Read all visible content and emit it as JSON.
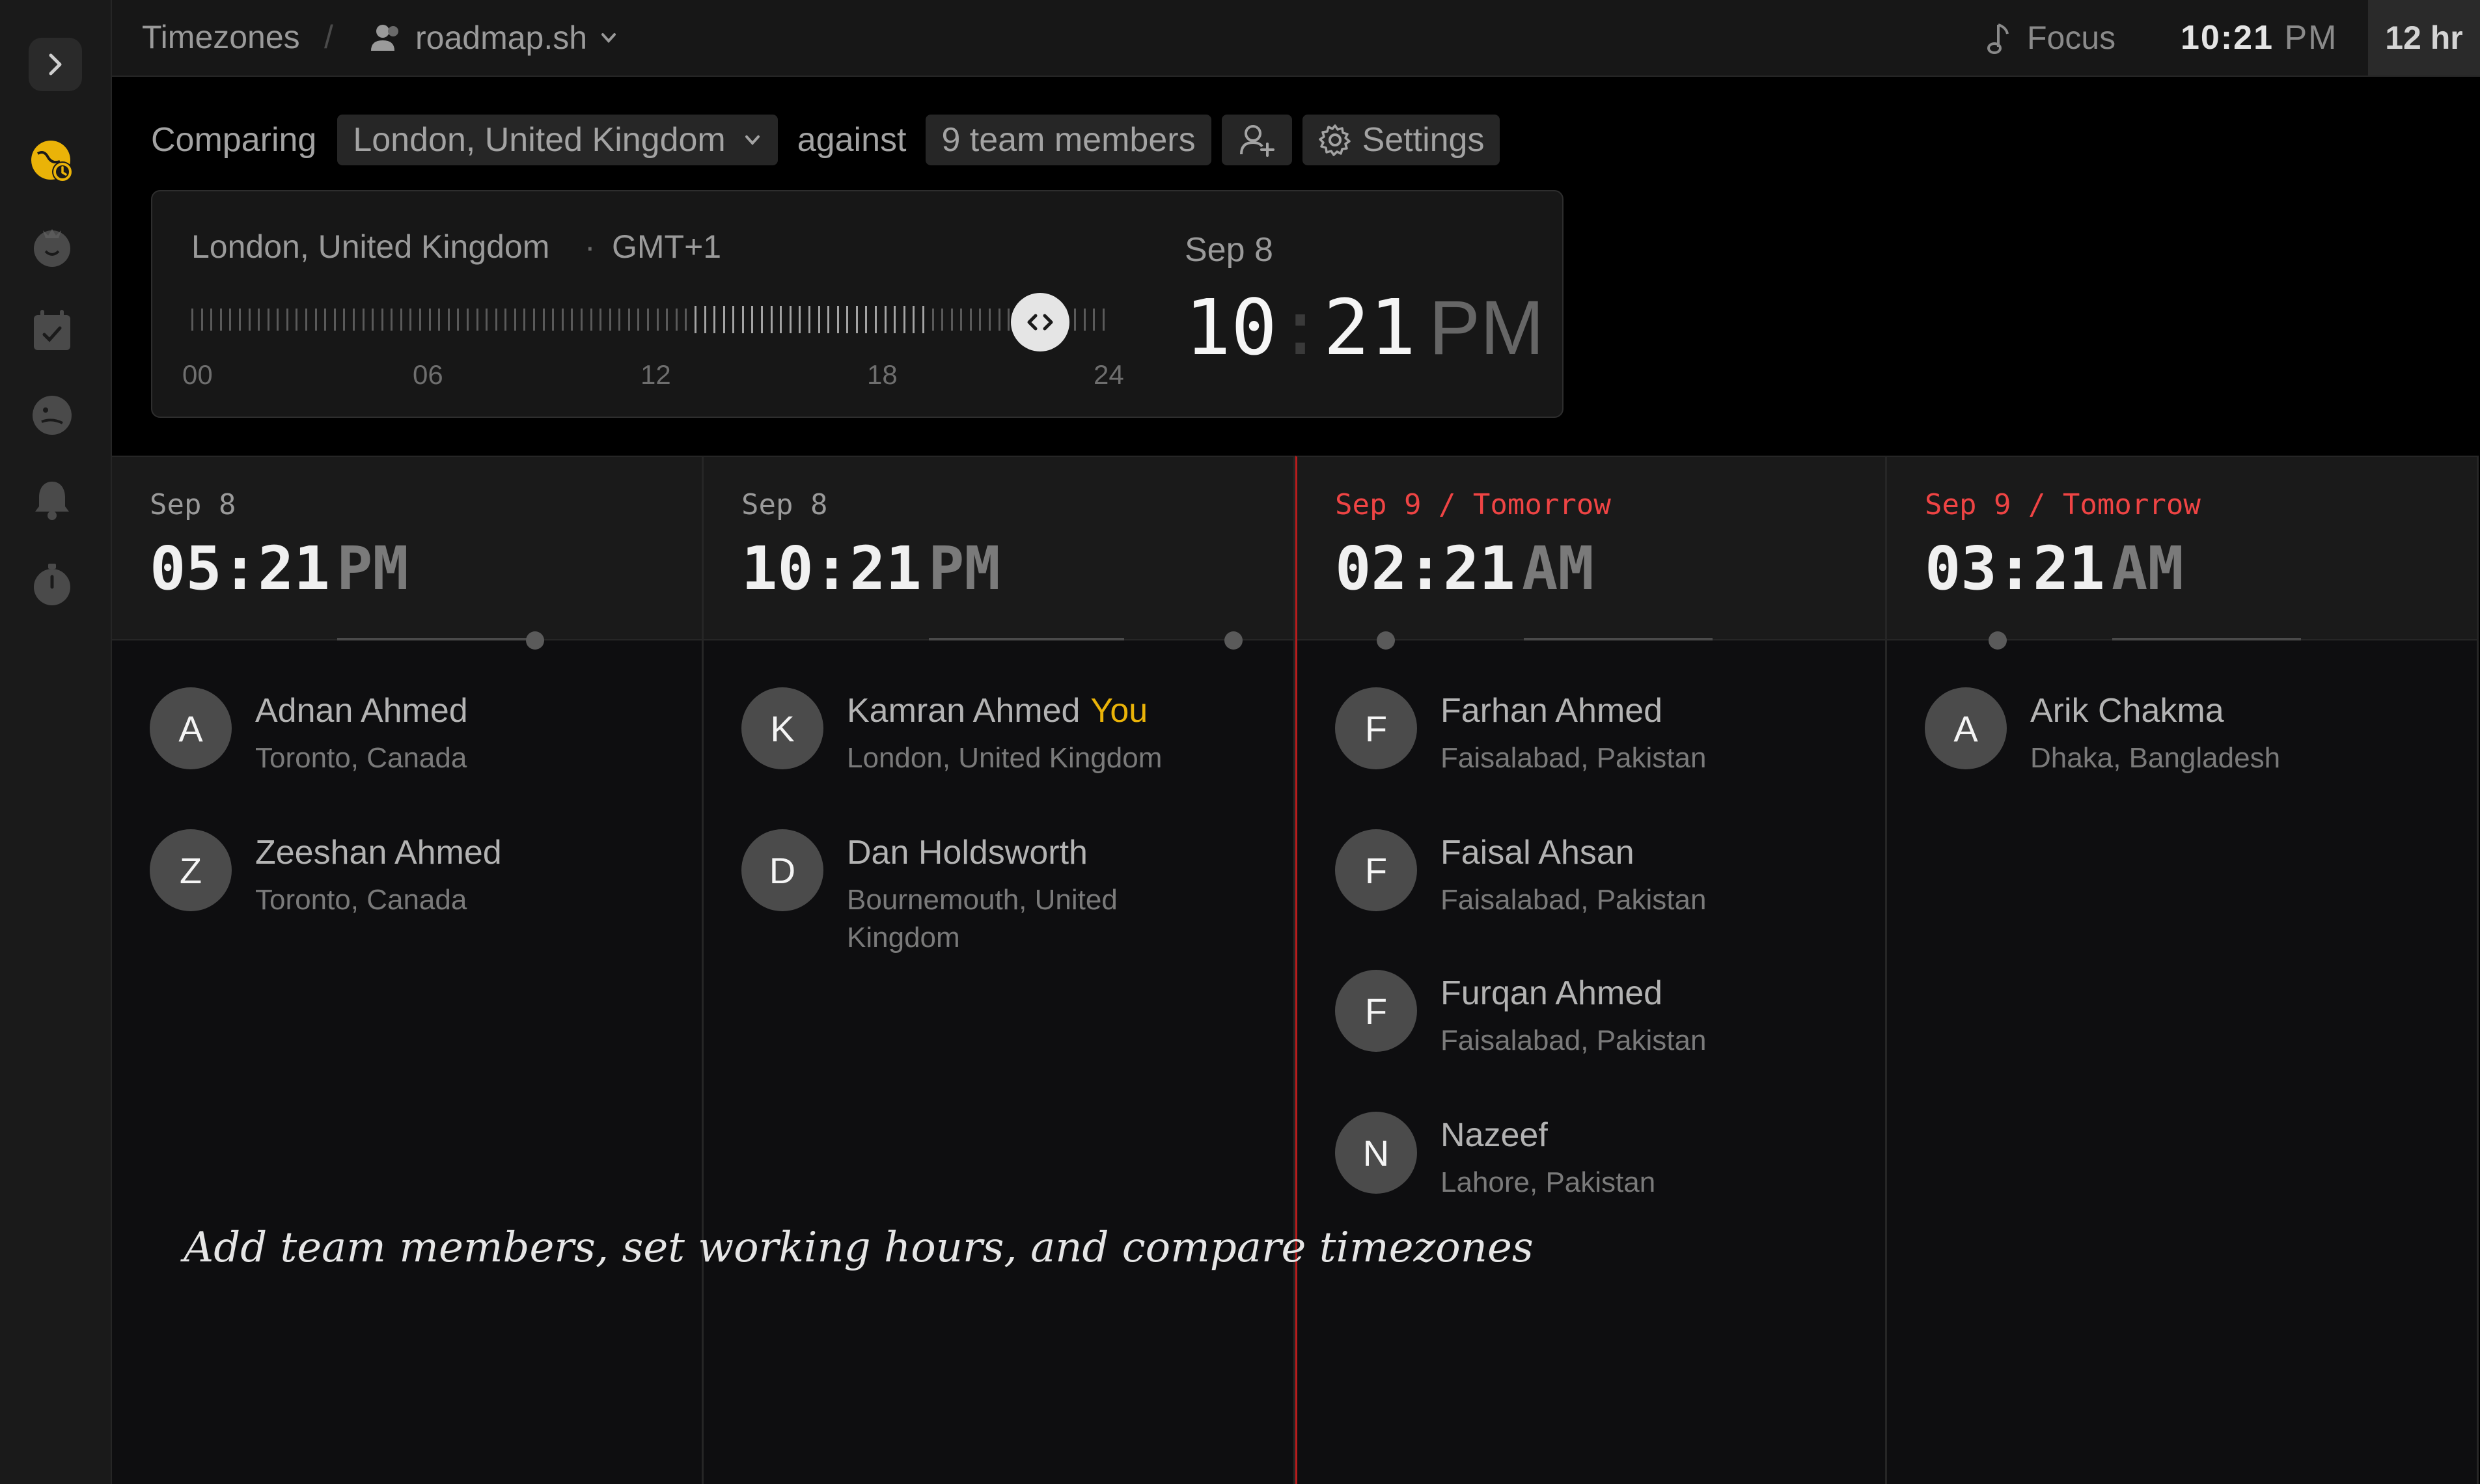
{
  "topbar": {
    "breadcrumb_root": "Timezones",
    "breadcrumb_sep": "/",
    "team_name": "roadmap.sh",
    "focus_label": "Focus",
    "current_time_hm": "10:21",
    "current_time_ampm": "PM",
    "hour_format": "12 hr"
  },
  "compare": {
    "comparing_label": "Comparing",
    "location": "London, United Kingdom",
    "against_label": "against",
    "members_label": "9 team members",
    "settings_label": "Settings"
  },
  "reference": {
    "location": "London, United Kingdom",
    "dot": "·",
    "offset": "GMT+1",
    "date": "Sep 8",
    "hour": "10",
    "colon": ":",
    "minute": "21",
    "ampm": "PM",
    "hour_labels": [
      "00",
      "06",
      "12",
      "18",
      "24"
    ],
    "slider_value_hours": 22.35
  },
  "columns": [
    {
      "date": "Sep 8",
      "date_highlight": false,
      "time": "05:21",
      "ampm": "PM",
      "members": [
        {
          "initial": "A",
          "name": "Adnan Ahmed",
          "city": "Toronto, Canada",
          "you": ""
        },
        {
          "initial": "Z",
          "name": "Zeeshan Ahmed",
          "city": "Toronto, Canada",
          "you": ""
        }
      ]
    },
    {
      "date": "Sep 8",
      "date_highlight": false,
      "time": "10:21",
      "ampm": "PM",
      "members": [
        {
          "initial": "K",
          "name": "Kamran Ahmed",
          "city": "London, United Kingdom",
          "you": "You"
        },
        {
          "initial": "D",
          "name": "Dan Holdsworth",
          "city": "Bournemouth, United Kingdom",
          "you": ""
        }
      ]
    },
    {
      "date": "Sep 9 / Tomorrow",
      "date_highlight": true,
      "time": "02:21",
      "ampm": "AM",
      "members": [
        {
          "initial": "F",
          "name": "Farhan Ahmed",
          "city": "Faisalabad, Pakistan",
          "you": ""
        },
        {
          "initial": "F",
          "name": "Faisal Ahsan",
          "city": "Faisalabad, Pakistan",
          "you": ""
        },
        {
          "initial": "F",
          "name": "Furqan Ahmed",
          "city": "Faisalabad, Pakistan",
          "you": ""
        },
        {
          "initial": "N",
          "name": "Nazeef",
          "city": "Lahore, Pakistan",
          "you": ""
        }
      ]
    },
    {
      "date": "Sep 9 / Tomorrow",
      "date_highlight": true,
      "time": "03:21",
      "ampm": "AM",
      "members": [
        {
          "initial": "A",
          "name": "Arik Chakma",
          "city": "Dhaka, Bangladesh",
          "you": ""
        }
      ]
    }
  ],
  "tagline": "Add team members, set working hours, and compare timezones",
  "colors": {
    "accent_yellow": "#eab308",
    "tomorrow_red": "#ef4444",
    "divider_red": "#b91c1c",
    "background": "#000000"
  },
  "icons": {
    "rail": [
      "chevron-right-icon",
      "timezone-clock-icon",
      "tomato-timer-icon",
      "calendar-check-icon",
      "face-icon",
      "bell-icon",
      "stopwatch-icon"
    ],
    "topbar": [
      "users-icon",
      "chevron-down-icon",
      "music-note-icon"
    ],
    "toolbar": [
      "chevron-down-icon",
      "user-plus-icon",
      "gear-icon"
    ]
  }
}
